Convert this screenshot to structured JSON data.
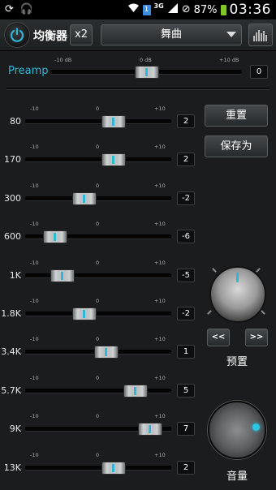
{
  "status_bar": {
    "network": "3G",
    "sim": "1",
    "battery": "87%",
    "time": "03:36",
    "icons": [
      "refresh-icon",
      "headphones-icon",
      "wifi-icon",
      "signal-icon",
      "no-disturb-icon",
      "battery-charging-icon"
    ]
  },
  "toolbar": {
    "title": "均衡器",
    "multiplier": "x2",
    "preset": "舞曲"
  },
  "preamp": {
    "label": "Preamp",
    "min_label": "-10 dB",
    "mid_label": "0 dB",
    "max_label": "+10 dB",
    "value": "0",
    "level": 0
  },
  "band_scale": {
    "min": "-10",
    "mid": "0",
    "max": "+10"
  },
  "bands": [
    {
      "freq": "80",
      "value": "2",
      "level": 2
    },
    {
      "freq": "170",
      "value": "2",
      "level": 2
    },
    {
      "freq": "300",
      "value": "-2",
      "level": -2
    },
    {
      "freq": "600",
      "value": "-6",
      "level": -6
    },
    {
      "freq": "1K",
      "value": "-5",
      "level": -5
    },
    {
      "freq": "1.8K",
      "value": "-2",
      "level": -2
    },
    {
      "freq": "3.4K",
      "value": "1",
      "level": 1
    },
    {
      "freq": "5.7K",
      "value": "5",
      "level": 5
    },
    {
      "freq": "9K",
      "value": "7",
      "level": 7
    },
    {
      "freq": "13K",
      "value": "2",
      "level": 2
    }
  ],
  "side": {
    "reset": "重置",
    "save_as": "保存为",
    "prev": "<<",
    "next": ">>",
    "preset_label": "预置",
    "volume_label": "音量"
  },
  "colors": {
    "accent": "#2fb7d8",
    "background": "#1a1c1d"
  }
}
